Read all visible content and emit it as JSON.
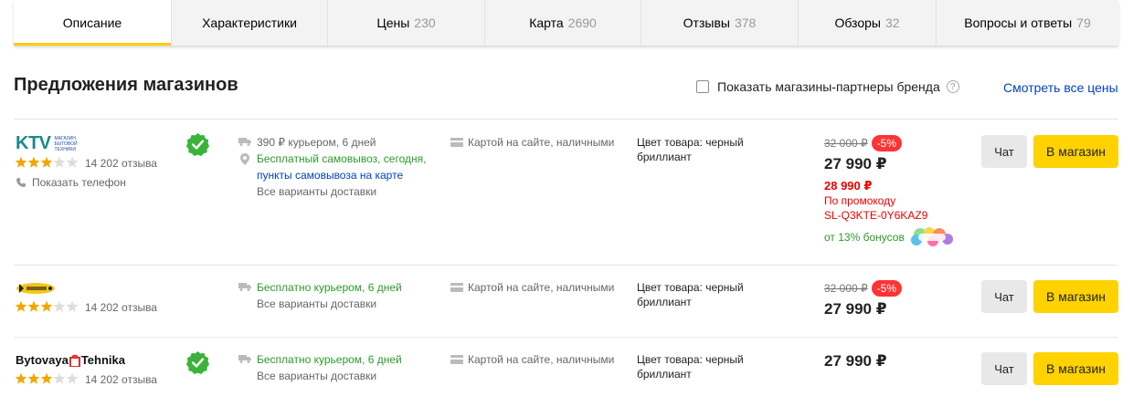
{
  "tabs": [
    {
      "label": "Описание",
      "count": "",
      "active": true
    },
    {
      "label": "Характеристики",
      "count": ""
    },
    {
      "label": "Цены",
      "count": "230"
    },
    {
      "label": "Карта",
      "count": "2690"
    },
    {
      "label": "Отзывы",
      "count": "378"
    },
    {
      "label": "Обзоры",
      "count": "32"
    },
    {
      "label": "Вопросы и ответы",
      "count": "79"
    }
  ],
  "header": {
    "title": "Предложения магазинов",
    "partner_checkbox_label": "Показать магазины-партнеры бренда",
    "help_glyph": "?",
    "all_prices_link": "Смотреть все цены"
  },
  "offers": [
    {
      "shop_logo_text": "KTV",
      "shop_logo_subtext": "магазин бытовой техники",
      "rating": 3,
      "reviews": "14 202 отзыва",
      "show_phone": "Показать телефон",
      "verified": true,
      "delivery": "390 ₽ курьером, 6 дней",
      "pickup": "Бесплатный самовывоз, сегодня,",
      "pickup_link": "пункты самовывоза на карте",
      "all_delivery": "Все варианты доставки",
      "payment": "Картой на сайте, наличными",
      "color": "Цвет товара: черный бриллиант",
      "old_price": "32 000 ₽",
      "discount": "-5%",
      "price": "27 990 ₽",
      "promo_price": "28 990 ₽",
      "promo_label": "По промокоду",
      "promo_code": "SL-Q3KTE-0Y6KAZ9",
      "bonus": "от 13% бонусов",
      "chat": "Чат",
      "to_shop": "В магазин"
    },
    {
      "shop_logo_text": "",
      "rating": 3,
      "reviews": "14 202 отзыва",
      "verified": false,
      "delivery": "Бесплатно курьером, 6 дней",
      "all_delivery": "Все варианты доставки",
      "payment": "Картой на сайте, наличными",
      "color": "Цвет товара: черный бриллиант",
      "old_price": "32 000 ₽",
      "discount": "-5%",
      "price": "27 990 ₽",
      "chat": "Чат",
      "to_shop": "В магазин"
    },
    {
      "shop_logo_text_a": "Bytovaya",
      "shop_logo_text_b": "Tehnika",
      "rating": 3,
      "reviews": "14 202 отзыва",
      "verified": true,
      "delivery": "Бесплатно курьером, 6 дней",
      "all_delivery": "Все варианты доставки",
      "payment": "Картой на сайте, наличными",
      "color": "Цвет товара: черный бриллиант",
      "price": "27 990 ₽",
      "chat": "Чат",
      "to_shop": "В магазин"
    }
  ],
  "colors": {
    "accent_yellow": "#ffd200",
    "tab_underline": "#ffcc00",
    "discount_red": "#ff3333",
    "promo_red": "#ee0000",
    "green": "#2b9a2b",
    "link_blue": "#0044bb",
    "star_filled": "#f2a700",
    "star_empty": "#dddddd"
  }
}
